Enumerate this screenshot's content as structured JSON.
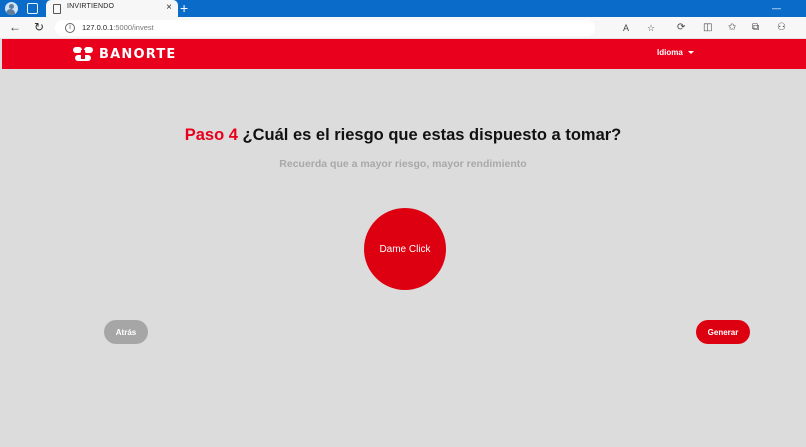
{
  "browser": {
    "tab_title": "INVIRTIENDO",
    "url_host": "127.0.0.1",
    "url_path": ":5000/invest",
    "new_tab_glyph": "+",
    "tab_close_glyph": "×",
    "icons": [
      "profile-icon",
      "tab-actions-icon",
      "page-icon",
      "close-icon",
      "new-tab-icon",
      "back-icon",
      "refresh-icon",
      "info-icon",
      "read-aloud-icon",
      "favorite-icon",
      "copilot-icon",
      "split-screen-icon",
      "favorites-icon",
      "collections-icon",
      "extensions-icon",
      "minimize-icon"
    ]
  },
  "header": {
    "brand": "BANORTE",
    "language_menu": "Idioma",
    "brand_color": "#e8001c"
  },
  "main": {
    "step_label": "Paso 4",
    "question": "¿Cuál es el riesgo que estas dispuesto a tomar?",
    "hint": "Recuerda que a mayor riesgo, mayor rendimiento",
    "risk_button": "Dame Click",
    "back_button": "Atrás",
    "generate_button": "Generar"
  }
}
